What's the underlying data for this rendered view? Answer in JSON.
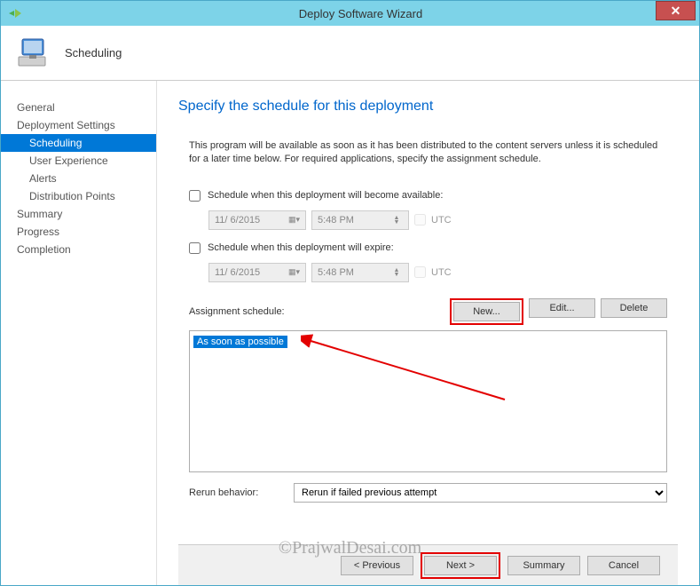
{
  "window": {
    "title": "Deploy Software Wizard"
  },
  "header": {
    "title": "Scheduling"
  },
  "sidebar": {
    "items": [
      {
        "label": "General",
        "type": "item"
      },
      {
        "label": "Deployment Settings",
        "type": "item"
      },
      {
        "label": "Scheduling",
        "type": "sub",
        "selected": true
      },
      {
        "label": "User Experience",
        "type": "sub"
      },
      {
        "label": "Alerts",
        "type": "sub"
      },
      {
        "label": "Distribution Points",
        "type": "sub"
      },
      {
        "label": "Summary",
        "type": "item"
      },
      {
        "label": "Progress",
        "type": "item"
      },
      {
        "label": "Completion",
        "type": "item"
      }
    ]
  },
  "content": {
    "page_title": "Specify the schedule for this deployment",
    "description": "This program will be available as soon as it has been distributed to the content servers unless it is scheduled for a later time below. For required applications, specify the assignment schedule.",
    "available_check_label": "Schedule when this deployment will become available:",
    "expire_check_label": "Schedule when this deployment will expire:",
    "date_available": "11/ 6/2015",
    "time_available": "5:48 PM",
    "date_expire": "11/ 6/2015",
    "time_expire": "5:48 PM",
    "utc_label": "UTC",
    "assignment_label": "Assignment schedule:",
    "new_btn": "New...",
    "edit_btn": "Edit...",
    "delete_btn": "Delete",
    "list_item": "As soon as possible",
    "rerun_label": "Rerun behavior:",
    "rerun_value": "Rerun if failed previous attempt"
  },
  "footer": {
    "previous": "< Previous",
    "next": "Next >",
    "summary": "Summary",
    "cancel": "Cancel"
  },
  "watermark": "©PrajwalDesai.com"
}
